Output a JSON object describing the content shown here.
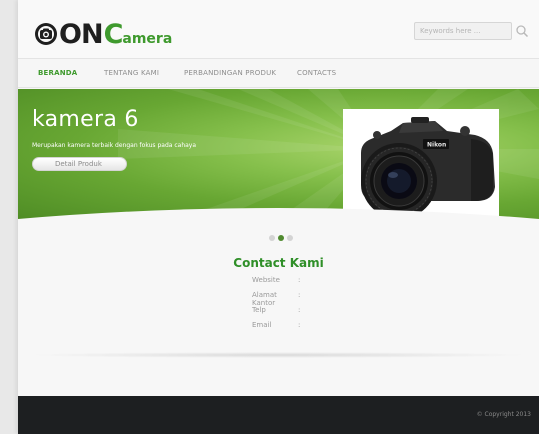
{
  "header": {
    "logo": {
      "part1": "ON",
      "part2": "C",
      "part3": "amera"
    },
    "search_placeholder": "Keywords here ..."
  },
  "nav": {
    "items": [
      {
        "label": "BERANDA",
        "active": true
      },
      {
        "label": "TENTANG KAMI",
        "active": false
      },
      {
        "label": "PERBANDINGAN PRODUK",
        "active": false
      },
      {
        "label": "CONTACTS",
        "active": false
      }
    ]
  },
  "hero": {
    "title": "kamera 6",
    "subtitle": "Merupakan kamera terbaik dengan fokus pada cahaya",
    "button_label": "Detail Produk",
    "camera_brand": "Nikon"
  },
  "slider": {
    "count": 3,
    "active_index": 1
  },
  "contact": {
    "title": "Contact Kami",
    "rows": [
      {
        "label": "Website",
        "sep": ":"
      },
      {
        "label": "Alamat Kantor",
        "sep": ":"
      },
      {
        "label": "Telp",
        "sep": ":"
      },
      {
        "label": "Email",
        "sep": ":"
      }
    ]
  },
  "footer": {
    "copyright": "© Copyright 2013"
  },
  "colors": {
    "brand_green": "#3f9a2e",
    "footer_bg": "#1d1f21",
    "hero_green": "#68a733"
  }
}
